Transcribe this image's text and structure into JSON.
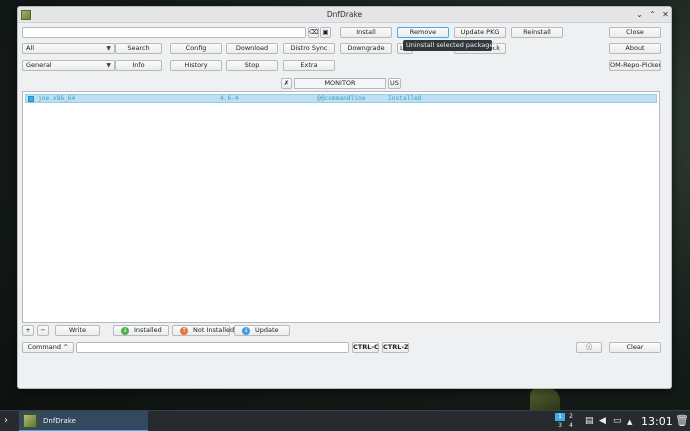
{
  "window": {
    "title": "DnfDrake",
    "minimize_glyph": "⌄",
    "maximize_glyph": "⌃",
    "close_glyph": "✕"
  },
  "toolbar": {
    "row1": {
      "install": "Install",
      "remove": "Remove",
      "update_pkg": "Update PKG",
      "reinstall": "Reinstall",
      "close": "Close"
    },
    "row2": {
      "filter_combo": "All",
      "search": "Search",
      "config": "Config",
      "download": "Download",
      "distro_sync": "Distro Sync",
      "downgrade": "Downgrade",
      "partial_left": "L",
      "partial_right": "ock",
      "about": "About"
    },
    "row3": {
      "group_combo": "General",
      "info": "Info",
      "history": "History",
      "stop": "Stop",
      "extra": "Extra",
      "om_repo_picker": "OM-Repo-Picker"
    }
  },
  "tooltip": "Uninstall selected packages",
  "monitor": {
    "label": "MONITOR",
    "lang": "US",
    "pin_glyph": "✗"
  },
  "packages": [
    {
      "name": "joe.x86_64",
      "version": "4.6-4",
      "repo": "@@commandline",
      "status": "Installed"
    }
  ],
  "bottom": {
    "add": "+",
    "remove": "−",
    "write": "Write",
    "installed": "Installed",
    "not_installed": "Not Installed",
    "update": "Update",
    "installed_glyph": "↓",
    "not_installed_glyph": "↑",
    "update_glyph": "↓",
    "command": "Command ^",
    "ctrl_c": "CTRL-C",
    "ctrl_z": "CTRL-Z",
    "info_glyph": "ⓘ",
    "clear": "Clear"
  },
  "icons": {
    "clear_input": "⌫",
    "folder": "▣"
  },
  "taskbar": {
    "task_label": "DnfDrake",
    "pager": [
      "1",
      "2",
      "3",
      "4"
    ],
    "clock": "13:01",
    "launcher_glyph": "›"
  },
  "colors": {
    "accent": "#3daee9",
    "selection_bg": "#bfe0f2",
    "selection_text": "#3aa2c8",
    "installed": "#4caf50",
    "not_installed": "#e8743b",
    "update": "#3d9be9"
  }
}
